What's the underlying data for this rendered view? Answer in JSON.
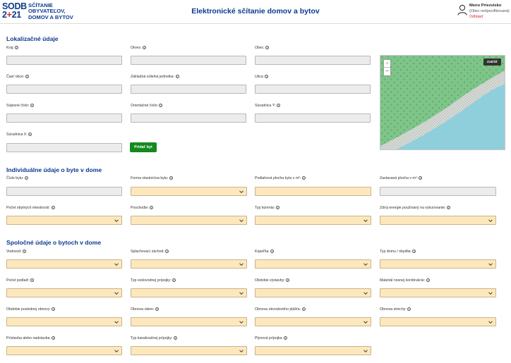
{
  "header": {
    "logo_mark_top": "SODB",
    "logo_mark_bottom_1": "2",
    "logo_mark_bottom_2": "+",
    "logo_mark_bottom_3": "21",
    "logo_line1": "SČÍTANIE",
    "logo_line2": "OBYVATEĽOV,",
    "logo_line3": "DOMOV A BYTOV",
    "title": "Elektronické sčítanie domov a bytov",
    "user_name": "Meno Priezvisko",
    "user_org": "(Obec nešpecifikovaná)",
    "logout": "Odhlásiť"
  },
  "section1": {
    "title": "Lokalizačné údaje",
    "kraj": "Kraj:",
    "okres": "Okres:",
    "obec": "Obec:",
    "cast_obce": "Časť obce:",
    "zsj": "Základná sídelná jednotka:",
    "ulica": "Ulica:",
    "supisne": "Súpisné číslo:",
    "orientacne": "Orientačné číslo:",
    "sur_y": "Súradnica Y:",
    "sur_x": "Súradnica X:",
    "add_button": "Pridať byt"
  },
  "map": {
    "zoom_in": "+",
    "zoom_out": "−",
    "button": "Zväčšiť"
  },
  "section2": {
    "title": "Individuálne údaje o byte v dome",
    "cislo_bytu": "Číslo bytu:",
    "forma": "Forma vlastníctva bytu:",
    "plocha": "Podlahová plocha bytu v m²:",
    "zastavana": "Zastavaná plocha v m²:",
    "miestnosti": "Počet obytných miestností:",
    "poschodie": "Poschodie:",
    "kurenie": "Typ kúrenia:",
    "zdroj": "Zdroj energie používaný na vykurovanie:"
  },
  "section3": {
    "title": "Spoločné údaje o bytoch v dome",
    "vodovod": "Vodovod:",
    "zachod": "Splachovací záchod:",
    "kupelna": "Kúpeľňa:",
    "typ_domu": "Typ domu / obydlia:",
    "podlazi": "Počet podlaží:",
    "vodovodna": "Typ vodovodnej prípojky:",
    "obdobie_vystavby": "Obdobie výstavby:",
    "material": "Materiál nosnej konštrukcie:",
    "obdobie_obnovy": "Obdobie poslednej obnovy:",
    "obnova_okien": "Obnova okien:",
    "obnova_plasta": "Obnova obvodového plášťa:",
    "obnova_strechy": "Obnova strechy:",
    "pristavba": "Prístavba alebo nadstavba:",
    "kanalizacna": "Typ kanalizačnej prípojky:",
    "plynova": "Plynová prípojka:"
  },
  "colors": {
    "brand_blue": "#0b3b8f",
    "brand_red": "#d6232a",
    "field_yellow": "#fde8bd",
    "field_grey": "#ececec",
    "button_green": "#138a1e"
  }
}
